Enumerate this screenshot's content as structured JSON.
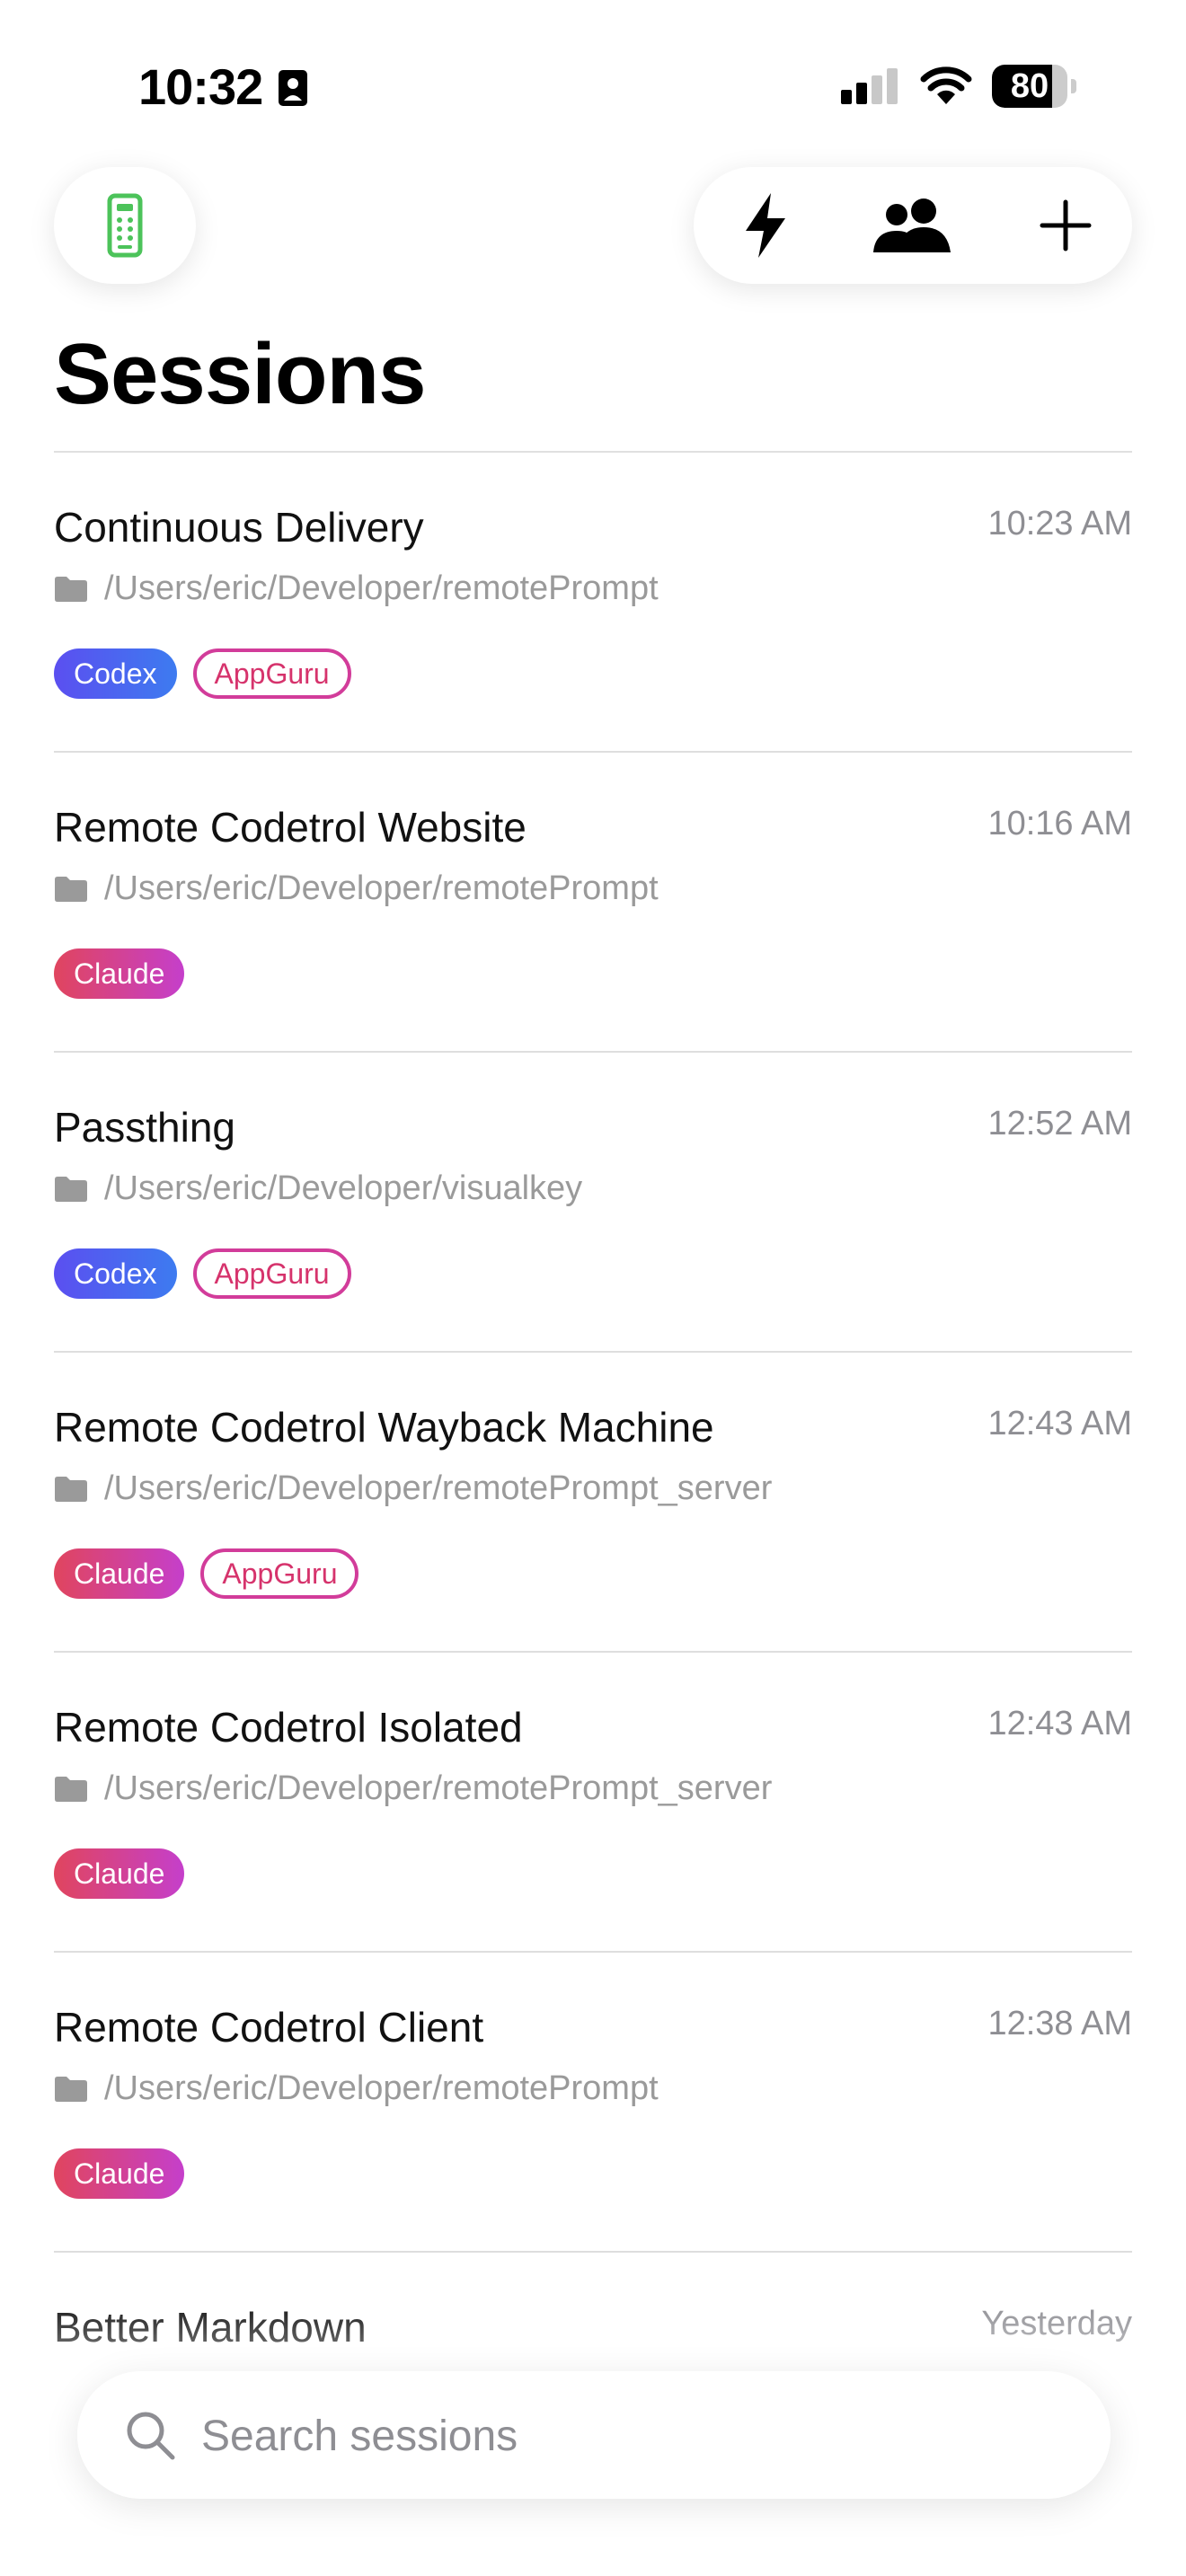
{
  "status_bar": {
    "time": "10:32",
    "battery_percent": 80,
    "battery_label": "80"
  },
  "toolbar": {
    "remote_icon": "remote-control-icon",
    "actions": [
      "lightning-icon",
      "people-icon",
      "plus-icon"
    ]
  },
  "page": {
    "title": "Sessions"
  },
  "sessions": [
    {
      "title": "Continuous Delivery",
      "time": "10:23 AM",
      "path": "/Users/eric/Developer/remotePrompt",
      "tags": [
        "Codex",
        "AppGuru"
      ]
    },
    {
      "title": "Remote Codetrol Website",
      "time": "10:16 AM",
      "path": "/Users/eric/Developer/remotePrompt",
      "tags": [
        "Claude"
      ]
    },
    {
      "title": "Passthing",
      "time": "12:52 AM",
      "path": "/Users/eric/Developer/visualkey",
      "tags": [
        "Codex",
        "AppGuru"
      ]
    },
    {
      "title": "Remote Codetrol Wayback Machine",
      "time": "12:43 AM",
      "path": "/Users/eric/Developer/remotePrompt_server",
      "tags": [
        "Claude",
        "AppGuru"
      ]
    },
    {
      "title": "Remote Codetrol Isolated",
      "time": "12:43 AM",
      "path": "/Users/eric/Developer/remotePrompt_server",
      "tags": [
        "Claude"
      ]
    },
    {
      "title": "Remote Codetrol Client",
      "time": "12:38 AM",
      "path": "/Users/eric/Developer/remotePrompt",
      "tags": [
        "Claude"
      ]
    },
    {
      "title": "Better Markdown",
      "time": "Yesterday",
      "path": "",
      "tags": []
    }
  ],
  "search": {
    "placeholder": "Search sessions",
    "value": ""
  },
  "colors": {
    "codex": "#4f5ff0",
    "claude": "#d9436f",
    "appguru": "#d23c9a",
    "remote_icon": "#4cc35a",
    "secondary_text": "#8e8e93"
  }
}
